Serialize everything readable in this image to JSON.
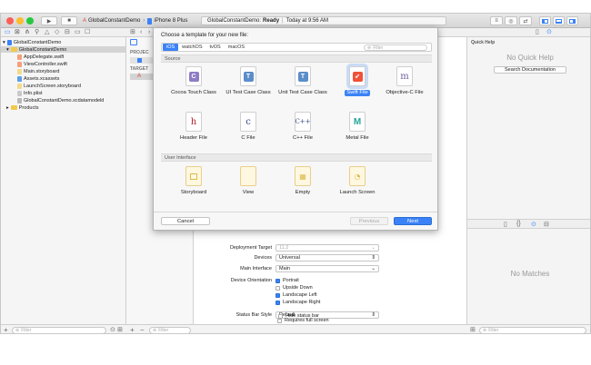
{
  "toolbar": {
    "scheme_name": "GlobalConstantDemo",
    "device_name": "iPhone 8 Plus",
    "status_project": "GlobalConstantDemo:",
    "status_state": "Ready",
    "status_time": "Today at 9:56 AM"
  },
  "sidebar": {
    "items": [
      {
        "label": "GlobalConstantDemo",
        "kind": "project"
      },
      {
        "label": "GlobalConstantDemo",
        "kind": "folder"
      },
      {
        "label": "AppDelegate.swift",
        "kind": "swift"
      },
      {
        "label": "ViewController.swift",
        "kind": "swift"
      },
      {
        "label": "Main.storyboard",
        "kind": "storyboard"
      },
      {
        "label": "Assets.xcassets",
        "kind": "assets"
      },
      {
        "label": "LaunchScreen.storyboard",
        "kind": "storyboard"
      },
      {
        "label": "Info.plist",
        "kind": "plist"
      },
      {
        "label": "GlobalConstantDemo.xcdatamodeld",
        "kind": "datamodel"
      },
      {
        "label": "Products",
        "kind": "folder"
      }
    ],
    "filter_placeholder": "Filter"
  },
  "projcol": {
    "project_header": "PROJEC",
    "targets_header": "TARGET"
  },
  "sheet": {
    "title": "Choose a template for your new file:",
    "platform_tabs": [
      "iOS",
      "watchOS",
      "tvOS",
      "macOS"
    ],
    "active_platform": "iOS",
    "filter_placeholder": "Filter",
    "source_section": "Source",
    "source_templates": [
      {
        "label": "Cocoa Touch Class",
        "glyph": "C",
        "color": "#8e7cc3"
      },
      {
        "label": "UI Test Case Class",
        "glyph": "T",
        "color": "#5b8dc9"
      },
      {
        "label": "Unit Test Case Class",
        "glyph": "T",
        "color": "#5b8dc9"
      },
      {
        "label": "Swift File",
        "glyph": "S",
        "color": "#f05138"
      },
      {
        "label": "Objective-C File",
        "glyph": "m",
        "color": "#6f5a9e"
      },
      {
        "label": "Header File",
        "glyph": "h",
        "color": "#b0202a"
      },
      {
        "label": "C File",
        "glyph": "c",
        "color": "#3a4a8a"
      },
      {
        "label": "C++ File",
        "glyph": "C++",
        "color": "#3a4a8a"
      },
      {
        "label": "Metal File",
        "glyph": "M",
        "color": "#26a69a"
      }
    ],
    "ui_section": "User Interface",
    "ui_templates": [
      {
        "label": "Storyboard"
      },
      {
        "label": "View"
      },
      {
        "label": "Empty"
      },
      {
        "label": "Launch Screen"
      }
    ],
    "cancel_label": "Cancel",
    "previous_label": "Previous",
    "next_label": "Next"
  },
  "editor": {
    "deployment_target_label": "Deployment Target",
    "deployment_target_value": "11.2",
    "devices_label": "Devices",
    "devices_value": "Universal",
    "main_interface_label": "Main Interface",
    "main_interface_value": "Main",
    "orientation_label": "Device Orientation",
    "orientations": [
      {
        "label": "Portrait",
        "checked": true
      },
      {
        "label": "Upside Down",
        "checked": false
      },
      {
        "label": "Landscape Left",
        "checked": true
      },
      {
        "label": "Landscape Right",
        "checked": true
      }
    ],
    "status_bar_label": "Status Bar Style",
    "status_bar_value": "Default",
    "hide_status_bar": "Hide status bar",
    "requires_full_screen": "Requires full screen"
  },
  "inspector": {
    "quick_help_header": "Quick Help",
    "no_quick_help": "No Quick Help",
    "search_docs": "Search Documentation",
    "no_matches": "No Matches",
    "filter_placeholder": "Filter"
  },
  "colors": {
    "accent": "#3b82f6",
    "close": "#fc5f57",
    "minimize": "#fdbc2e",
    "zoom": "#28c840"
  }
}
